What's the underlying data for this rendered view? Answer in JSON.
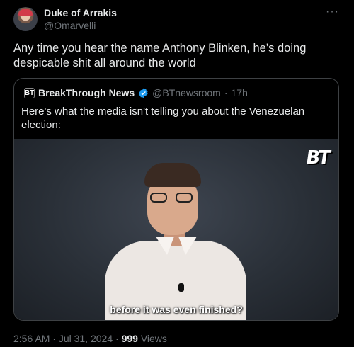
{
  "author": {
    "name": "Duke of Arrakis",
    "handle": "@Omarvelli",
    "more_icon": "more-horizontal-icon"
  },
  "tweet": {
    "text": "Any time you hear the name Anthony Blinken, he’s doing despicable shit all around the world"
  },
  "quote": {
    "logo_text": "BT",
    "name": "BreakThrough News",
    "verified_color": "#1d9bf0",
    "handle": "@BTnewsroom",
    "separator": "·",
    "time": "17h",
    "text": "Here's what the media isn't telling you about the Venezuelan election:",
    "video": {
      "watermark": "BT",
      "caption": "before it was even finished?"
    }
  },
  "meta": {
    "time": "2:56 AM",
    "sep1": "·",
    "date": "Jul 31, 2024",
    "sep2": "·",
    "views_count": "999",
    "views_label": "Views"
  }
}
